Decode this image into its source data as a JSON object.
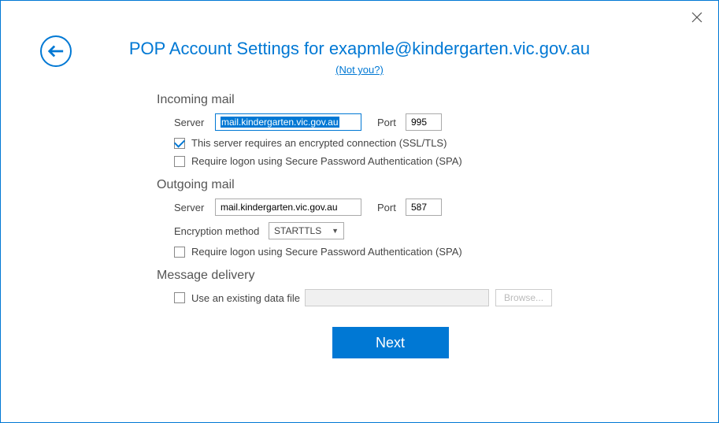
{
  "header": {
    "title": "POP Account Settings for exapmle@kindergarten.vic.gov.au",
    "not_you": "(Not you?)"
  },
  "incoming": {
    "heading": "Incoming mail",
    "server_label": "Server",
    "server_value": "mail.kindergarten.vic.gov.au",
    "port_label": "Port",
    "port_value": "995",
    "ssl_checked": true,
    "ssl_label": "This server requires an encrypted connection (SSL/TLS)",
    "spa_checked": false,
    "spa_label": "Require logon using Secure Password Authentication (SPA)"
  },
  "outgoing": {
    "heading": "Outgoing mail",
    "server_label": "Server",
    "server_value": "mail.kindergarten.vic.gov.au",
    "port_label": "Port",
    "port_value": "587",
    "enc_label": "Encryption method",
    "enc_value": "STARTTLS",
    "spa_checked": false,
    "spa_label": "Require logon using Secure Password Authentication (SPA)"
  },
  "delivery": {
    "heading": "Message delivery",
    "use_existing_checked": false,
    "use_existing_label": "Use an existing data file",
    "browse_label": "Browse..."
  },
  "buttons": {
    "next": "Next"
  }
}
